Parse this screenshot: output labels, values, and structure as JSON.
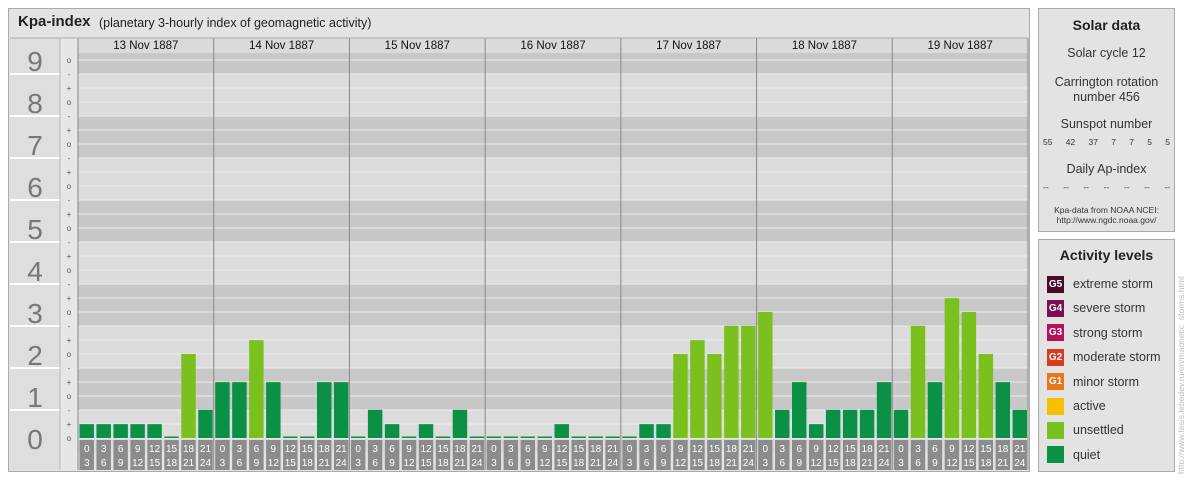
{
  "title": "Kpa-index",
  "subtitle": "(planetary 3-hourly index of geomagnetic activity)",
  "chart_data": {
    "type": "bar",
    "y_axis_levels": [
      "0",
      "1",
      "2",
      "3",
      "4",
      "5",
      "6",
      "7",
      "8",
      "9"
    ],
    "sub_ticks": [
      "o",
      "+",
      "-"
    ],
    "ylim": [
      0,
      9.33
    ],
    "interval_labels": [
      [
        "0",
        "3"
      ],
      [
        "3",
        "6"
      ],
      [
        "6",
        "9"
      ],
      [
        "9",
        "12"
      ],
      [
        "12",
        "15"
      ],
      [
        "15",
        "18"
      ],
      [
        "18",
        "21"
      ],
      [
        "21",
        "24"
      ]
    ],
    "days": [
      {
        "date": "13 Nov 1887",
        "values": [
          0.33,
          0.33,
          0.33,
          0.33,
          0.33,
          0,
          2,
          0.67
        ]
      },
      {
        "date": "14 Nov 1887",
        "values": [
          1.33,
          1.33,
          2.33,
          1.33,
          0,
          0,
          1.33,
          1.33
        ]
      },
      {
        "date": "15 Nov 1887",
        "values": [
          0,
          0.67,
          0.33,
          0,
          0.33,
          0,
          0.67,
          0
        ]
      },
      {
        "date": "16 Nov 1887",
        "values": [
          0,
          0,
          0,
          0,
          0.33,
          0,
          0,
          0
        ]
      },
      {
        "date": "17 Nov 1887",
        "values": [
          0,
          0.33,
          0.33,
          2,
          2.33,
          2,
          2.67,
          2.67
        ]
      },
      {
        "date": "18 Nov 1887",
        "values": [
          3,
          0.67,
          1.33,
          0.33,
          0.67,
          0.67,
          0.67,
          1.33
        ]
      },
      {
        "date": "19 Nov 1887",
        "values": [
          0.67,
          2.67,
          1.33,
          3.33,
          3,
          2,
          1.33,
          0.67
        ]
      }
    ]
  },
  "solar": {
    "heading": "Solar data",
    "solar_cycle": "Solar cycle 12",
    "carrington_line1": "Carrington rotation",
    "carrington_line2": "number 456",
    "sunspot_heading": "Sunspot number",
    "sunspot_values": [
      "55",
      "42",
      "37",
      "7",
      "7",
      "5",
      "5"
    ],
    "ap_heading": "Daily Ap-index",
    "ap_values": [
      "--",
      "--",
      "--",
      "--",
      "--",
      "--",
      "--"
    ],
    "source_line1": "Kpa-data from NOAA NCEI:",
    "source_line2": "http://www.ngdc.noaa.gov/"
  },
  "activity": {
    "heading": "Activity levels",
    "levels": [
      {
        "code": "G5",
        "label": "extreme storm",
        "color": "#4a0a2e"
      },
      {
        "code": "G4",
        "label": "severe storm",
        "color": "#7a1050"
      },
      {
        "code": "G3",
        "label": "strong storm",
        "color": "#b5105e"
      },
      {
        "code": "G2",
        "label": "moderate storm",
        "color": "#d63c1e"
      },
      {
        "code": "G1",
        "label": "minor storm",
        "color": "#e8761a"
      },
      {
        "code": "",
        "label": "active",
        "color": "#f5c000"
      },
      {
        "code": "",
        "label": "unsettled",
        "color": "#7ac11f"
      },
      {
        "code": "",
        "label": "quiet",
        "color": "#0a9145"
      }
    ]
  },
  "watermark": "http://www.tesis.lebedev.ru/en/magnetic_storms.html"
}
